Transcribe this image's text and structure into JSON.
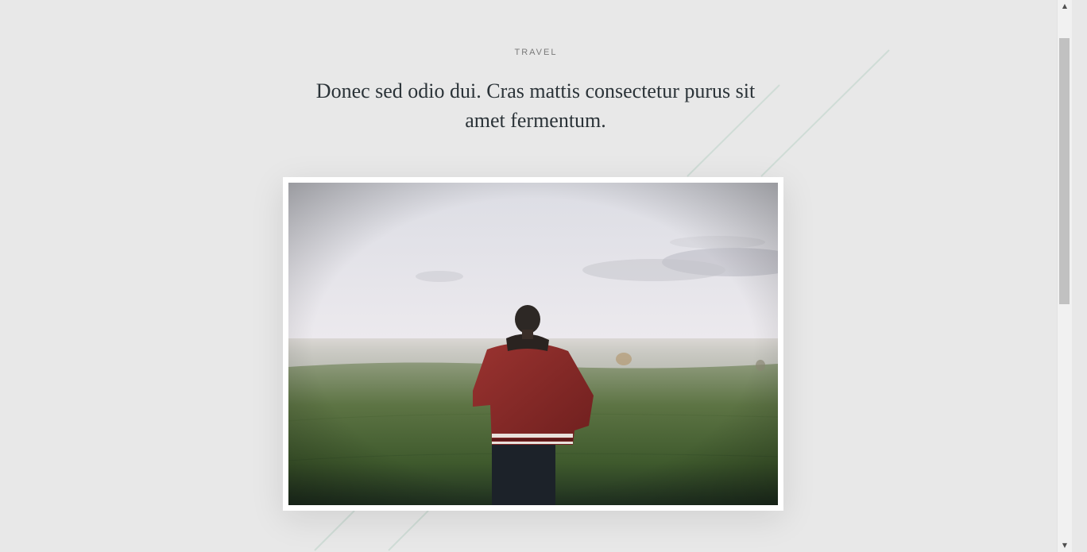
{
  "article": {
    "category": "TRAVEL",
    "headline": "Donec sed odio dui. Cras mattis consectetur purus sit amet fermentum."
  },
  "photo": {
    "subject": "person in red jacket standing in misty green field"
  },
  "icons": {
    "scroll_up": "▲",
    "scroll_down": "▼"
  },
  "colors": {
    "background": "#e8e8e8",
    "headline": "#2b3338",
    "category": "#7a7a7a",
    "accent_lines": "#cfdcd6",
    "jacket": "#8a2a28"
  }
}
